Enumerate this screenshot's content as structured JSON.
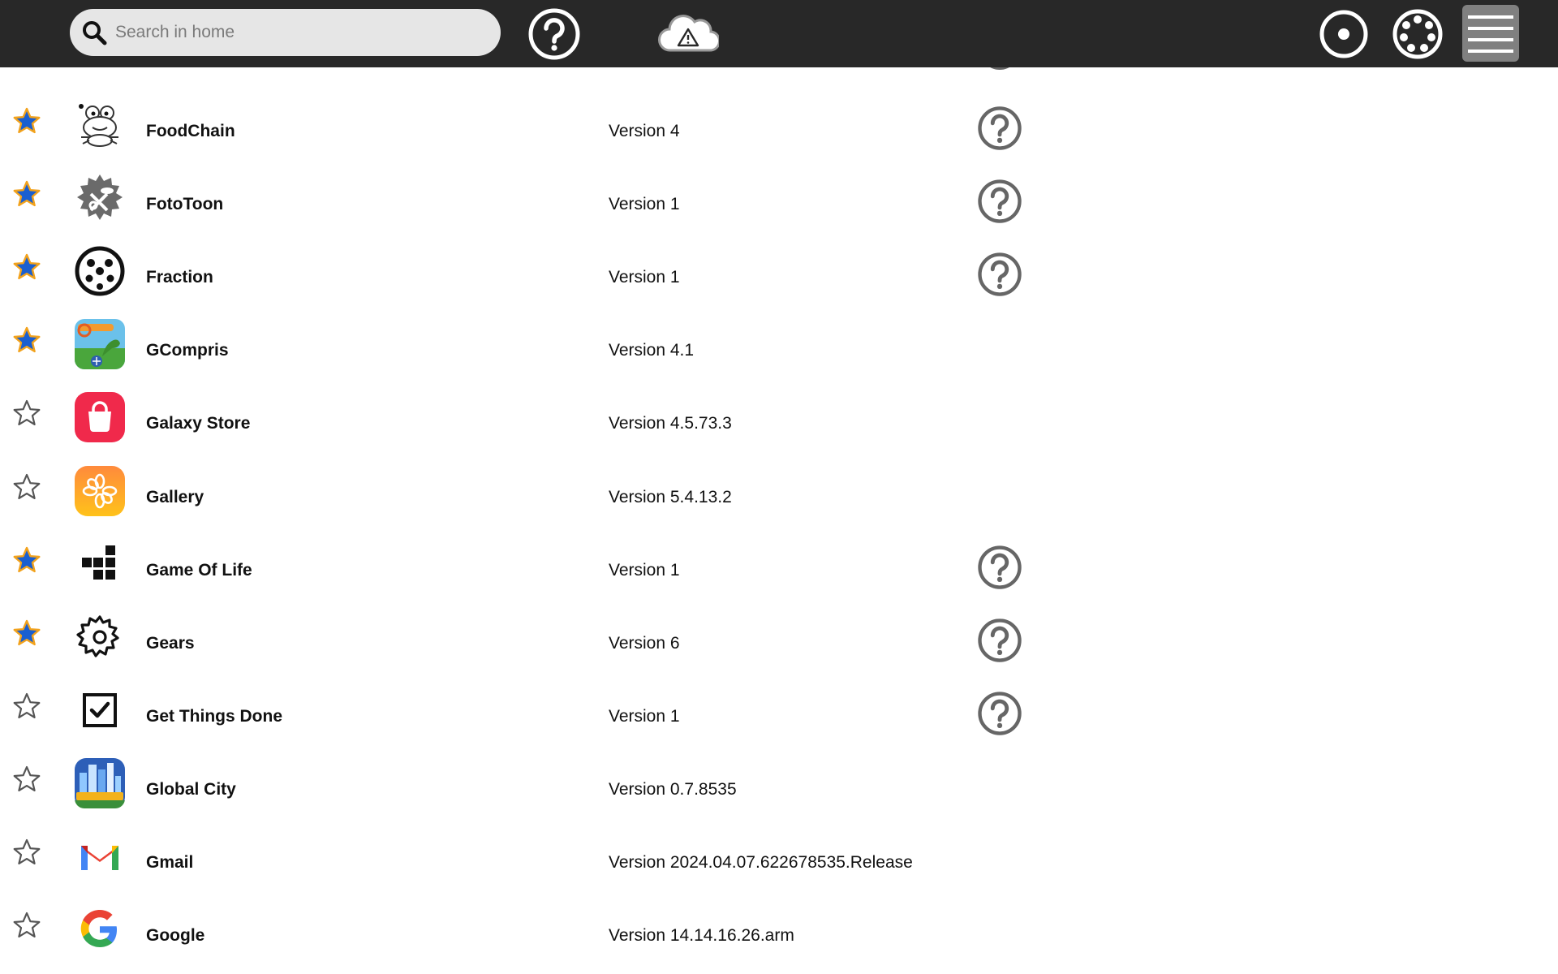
{
  "search": {
    "placeholder": "Search in home"
  },
  "toolbar": {
    "help_icon": "help-circle-icon",
    "cloud_icon": "cloud-warning-icon",
    "home_view_icon": "home-view-icon",
    "neighborhood_icon": "neighborhood-view-icon",
    "menu_icon": "hamburger-menu-icon"
  },
  "colors": {
    "topbar": "#282828",
    "search_bg": "#e6e6e6",
    "favorite_star_fill": "#1a5fd0",
    "favorite_star_stroke": "#f2a21c",
    "help_icon": "#666666",
    "menu_button": "#808080"
  },
  "apps": [
    {
      "name": "FoodChain",
      "version": "Version 4",
      "favorite": true,
      "help": true,
      "icon": "frog-icon"
    },
    {
      "name": "FotoToon",
      "version": "Version 1",
      "favorite": true,
      "help": true,
      "icon": "fototoon-icon"
    },
    {
      "name": "Fraction",
      "version": "Version 1",
      "favorite": true,
      "help": true,
      "icon": "soccer-ball-icon"
    },
    {
      "name": "GCompris",
      "version": "Version 4.1",
      "favorite": true,
      "help": false,
      "icon": "gcompris-icon"
    },
    {
      "name": "Galaxy Store",
      "version": "Version 4.5.73.3",
      "favorite": false,
      "help": false,
      "icon": "shopping-bag-icon"
    },
    {
      "name": "Gallery",
      "version": "Version 5.4.13.2",
      "favorite": false,
      "help": false,
      "icon": "gallery-flower-icon"
    },
    {
      "name": "Game Of Life",
      "version": "Version 1",
      "favorite": true,
      "help": true,
      "icon": "glider-icon"
    },
    {
      "name": "Gears",
      "version": "Version 6",
      "favorite": true,
      "help": true,
      "icon": "gear-icon"
    },
    {
      "name": "Get Things Done",
      "version": "Version 1",
      "favorite": false,
      "help": true,
      "icon": "checkbox-icon"
    },
    {
      "name": "Global City",
      "version": "Version 0.7.8535",
      "favorite": false,
      "help": false,
      "icon": "city-icon"
    },
    {
      "name": "Gmail",
      "version": "Version 2024.04.07.622678535.Release",
      "favorite": false,
      "help": false,
      "icon": "gmail-icon"
    },
    {
      "name": "Google",
      "version": "Version 14.14.16.26.arm",
      "favorite": false,
      "help": false,
      "icon": "google-g-icon"
    }
  ]
}
